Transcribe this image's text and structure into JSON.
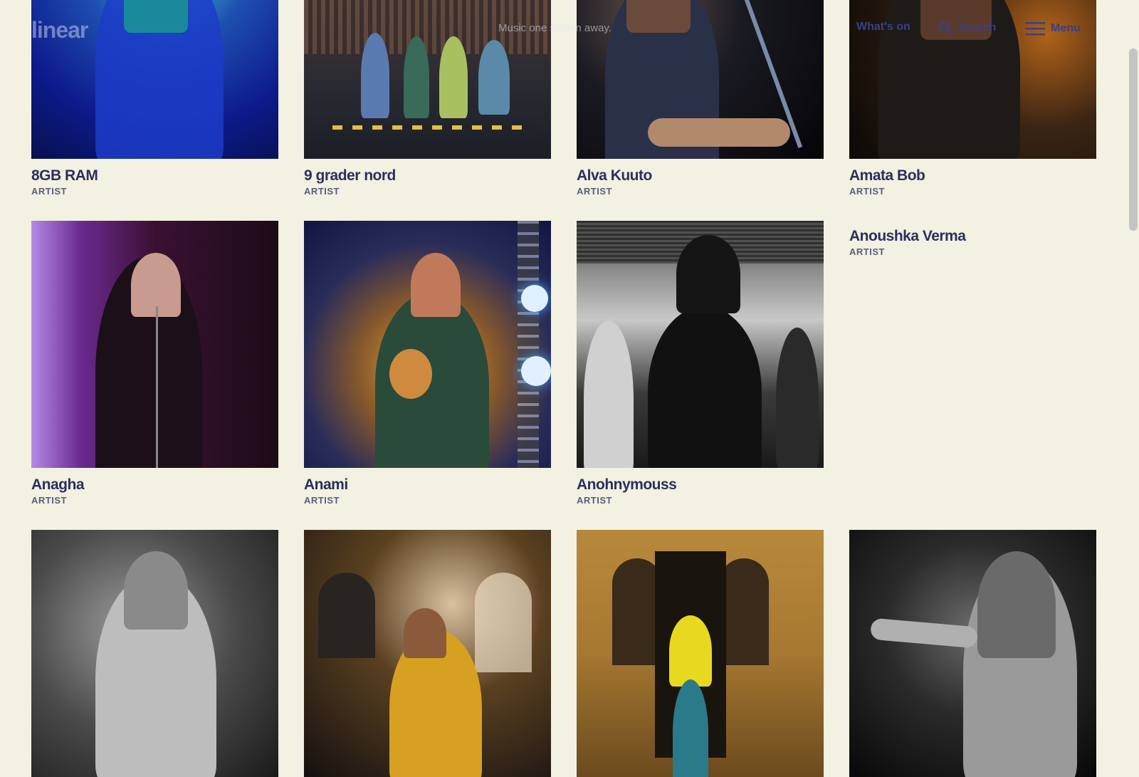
{
  "header": {
    "logo": "linear",
    "tagline": "Music one station away.",
    "nav": {
      "whats_on": "What's on",
      "search": "Search",
      "menu": "Menu"
    }
  },
  "artists": [
    {
      "name": "8GB RAM",
      "type": "ARTIST"
    },
    {
      "name": "9 grader nord",
      "type": "ARTIST"
    },
    {
      "name": "Alva Kuuto",
      "type": "ARTIST"
    },
    {
      "name": "Amata Bob",
      "type": "ARTIST"
    },
    {
      "name": "Anagha",
      "type": "ARTIST"
    },
    {
      "name": "Anami",
      "type": "ARTIST"
    },
    {
      "name": "Anohnymouss",
      "type": "ARTIST"
    },
    {
      "name": "Anoushka Verma",
      "type": "ARTIST"
    }
  ]
}
